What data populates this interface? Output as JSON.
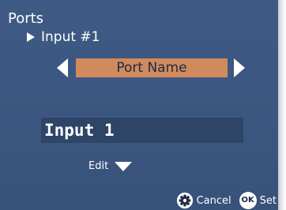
{
  "screen": {
    "title": "Ports",
    "breadcrumb": "Input #1"
  },
  "selector": {
    "field_label": "Port Name"
  },
  "editor": {
    "value": "Input 1",
    "edit_label": "Edit"
  },
  "footer": {
    "cancel_label": "Cancel",
    "ok_icon_text": "OK",
    "set_label": "Set"
  },
  "colors": {
    "background": "#3d5882",
    "field_highlight": "#d08a5c",
    "value_box": "#2e4567",
    "text": "#ffffff"
  },
  "icons": [
    "triangle-right-icon",
    "chevron-left-icon",
    "chevron-right-icon",
    "triangle-down-icon",
    "gear-icon",
    "ok-button-icon"
  ]
}
